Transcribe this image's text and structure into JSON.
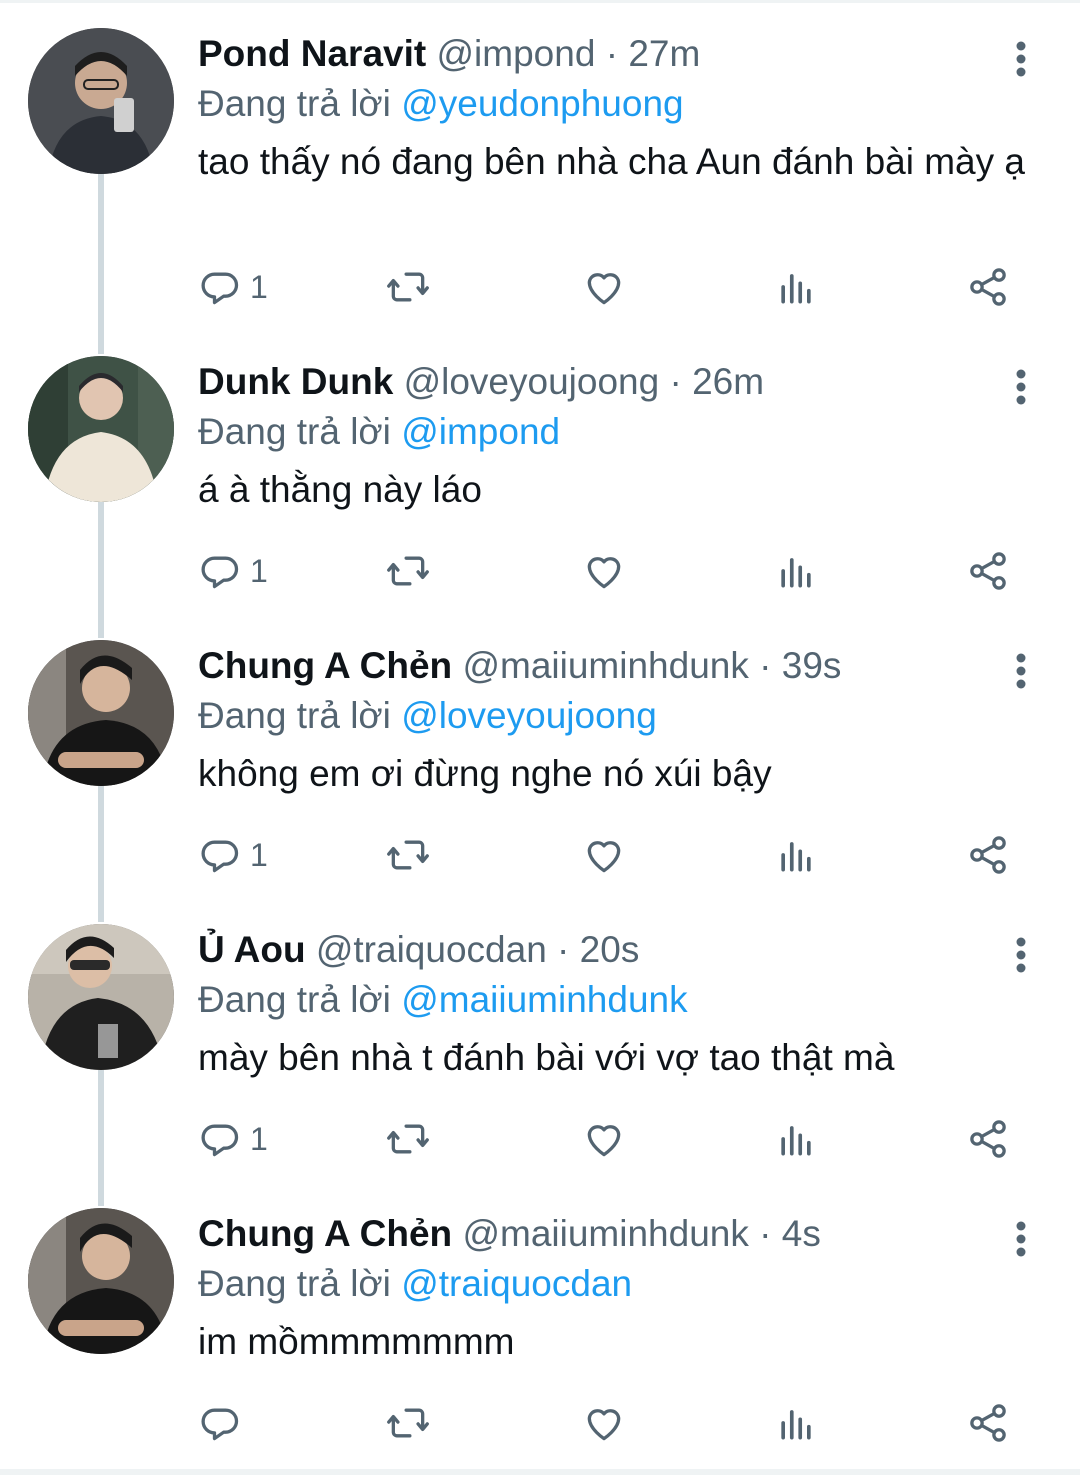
{
  "tweets": [
    {
      "display_name": "Pond Naravit",
      "handle": "@impond",
      "separator": " · ",
      "time": "27m",
      "reply_prefix": "Đang trả lời ",
      "reply_to": "@yeudonphuong",
      "text": "tao thấy nó đang bên nhà cha Aun đánh bài mày ạ",
      "reply_count": "1"
    },
    {
      "display_name": "Dunk Dunk",
      "handle": "@loveyoujoong",
      "separator": " · ",
      "time": "26m",
      "reply_prefix": "Đang trả lời ",
      "reply_to": "@impond",
      "text": "á à thằng này láo",
      "reply_count": "1"
    },
    {
      "display_name": "Chung A Chẻn",
      "handle": "@maiiuminhdunk",
      "separator": " · ",
      "time": "39s",
      "reply_prefix": "Đang trả lời ",
      "reply_to": "@loveyoujoong",
      "text": "không em ơi đừng nghe nó xúi bậy",
      "reply_count": "1"
    },
    {
      "display_name": "Ủ Aou",
      "handle": "@traiquocdan",
      "separator": " · ",
      "time": "20s",
      "reply_prefix": "Đang trả lời ",
      "reply_to": "@maiiuminhdunk",
      "text": "mày bên nhà t đánh bài với vợ tao thật mà",
      "reply_count": "1"
    },
    {
      "display_name": "Chung A Chẻn",
      "handle": "@maiiuminhdunk",
      "separator": " · ",
      "time": "4s",
      "reply_prefix": "Đang trả lời ",
      "reply_to": "@traiquocdan",
      "text": "im mồmmmmmmm",
      "reply_count": ""
    }
  ],
  "icons": {
    "reply": "comment-icon",
    "retweet": "retweet-icon",
    "like": "heart-icon",
    "views": "views-icon",
    "share": "share-icon",
    "more": "more-vertical-icon"
  },
  "colors": {
    "text": "#0f1419",
    "secondary": "#536471",
    "mention": "#1d9bf0",
    "thread_line": "#cfd9de"
  }
}
